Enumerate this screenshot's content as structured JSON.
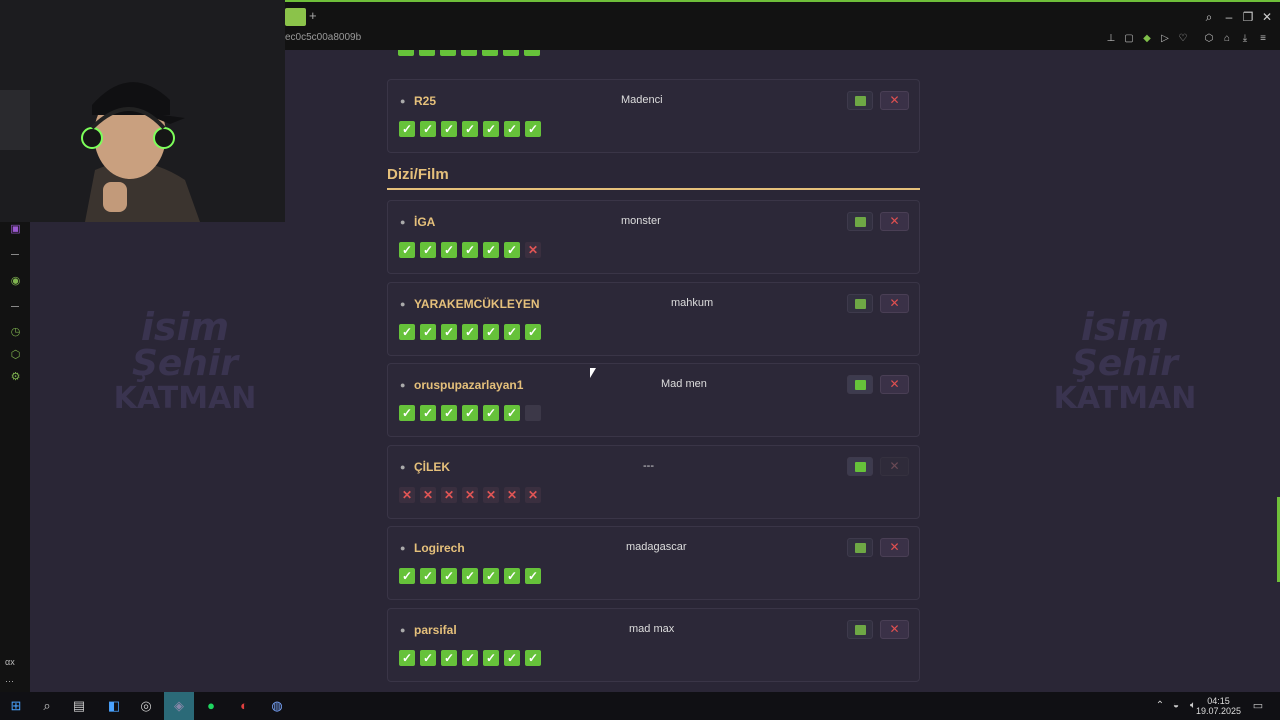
{
  "browser": {
    "url_fragment": "ec0c5c00a8009b",
    "new_tab_label": "+",
    "window_controls": [
      "search-icon",
      "minimize-icon",
      "restore-icon",
      "close-icon"
    ],
    "accent": "#6fbf3a"
  },
  "sidebar": {
    "bottom_text": "αx",
    "more": "···"
  },
  "watermark": {
    "line1": "isim",
    "line2": "Şehir",
    "line3": "KATMAN"
  },
  "section": {
    "title": "Dizi/Film"
  },
  "top_card": {
    "username": "R25",
    "answer": "Madenci",
    "results": [
      "ok",
      "ok",
      "ok",
      "ok",
      "ok",
      "ok",
      "ok"
    ]
  },
  "cards": [
    {
      "username": "İGA",
      "answer": "monster",
      "results": [
        "ok",
        "ok",
        "ok",
        "ok",
        "ok",
        "ok",
        "no"
      ],
      "ok_active": false,
      "x_dim": false
    },
    {
      "username": "YARAKEMCÜKLEYEN",
      "answer": "mahkum",
      "results": [
        "ok",
        "ok",
        "ok",
        "ok",
        "ok",
        "ok",
        "ok"
      ],
      "ok_active": false,
      "x_dim": false
    },
    {
      "username": "oruspupazarlayan1",
      "answer": "Mad men",
      "results": [
        "ok",
        "ok",
        "ok",
        "ok",
        "ok",
        "ok",
        "empty"
      ],
      "ok_active": true,
      "x_dim": false
    },
    {
      "username": "ÇİLEK",
      "answer": "---",
      "results": [
        "no",
        "no",
        "no",
        "no",
        "no",
        "no",
        "no"
      ],
      "ok_active": true,
      "x_dim": true
    },
    {
      "username": "Logirech",
      "answer": "madagascar",
      "results": [
        "ok",
        "ok",
        "ok",
        "ok",
        "ok",
        "ok",
        "ok"
      ],
      "ok_active": false,
      "x_dim": false
    },
    {
      "username": "parsifal",
      "answer": "mad max",
      "results": [
        "ok",
        "ok",
        "ok",
        "ok",
        "ok",
        "ok",
        "ok"
      ],
      "ok_active": false,
      "x_dim": false
    }
  ],
  "glyphs": {
    "ok": "✓",
    "no": "✕",
    "x_button": "✕",
    "user_icon": "👤"
  },
  "taskbar": {
    "time": "04:15",
    "date": "19.07.2025"
  }
}
